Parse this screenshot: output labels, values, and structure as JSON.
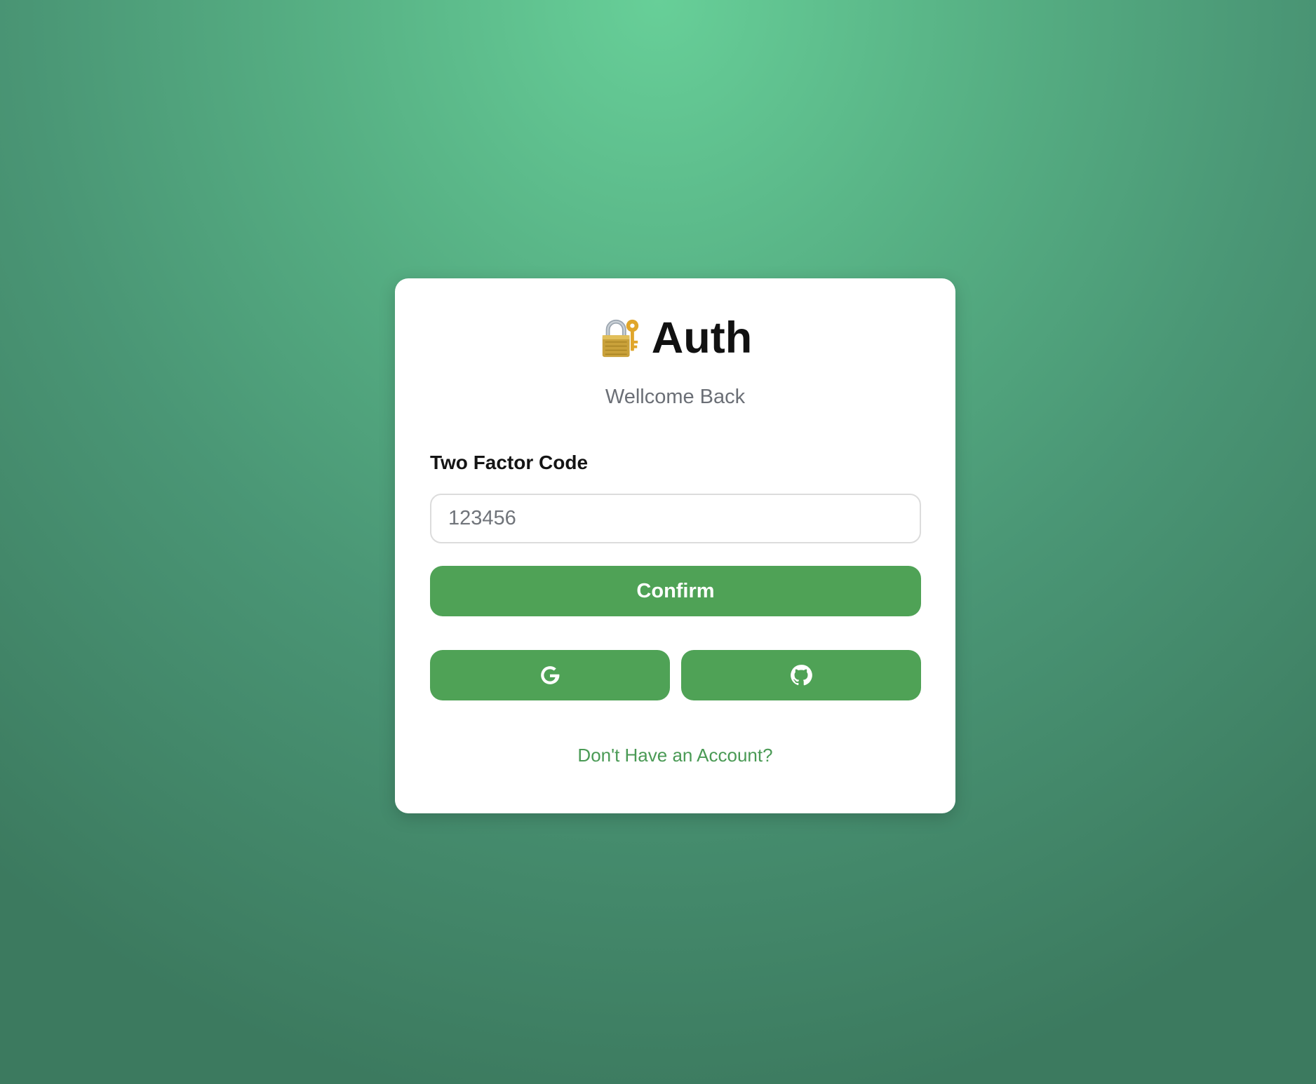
{
  "page": {
    "background_colors": [
      "#67cf98",
      "#4a9675",
      "#3c7a5f"
    ]
  },
  "card": {
    "icon": "lock-with-key-icon",
    "title": "Auth",
    "subtitle": "Wellcome Back"
  },
  "form": {
    "code_label": "Two Factor Code",
    "code_placeholder": "123456",
    "code_value": "",
    "confirm_label": "Confirm"
  },
  "social": {
    "google_icon": "google-icon",
    "github_icon": "github-icon"
  },
  "footer": {
    "signup_link": "Don't Have an Account?"
  },
  "colors": {
    "accent": "#4fa256",
    "link": "#4a9a55",
    "card_bg": "#ffffff",
    "muted_text": "#6b6f76"
  }
}
